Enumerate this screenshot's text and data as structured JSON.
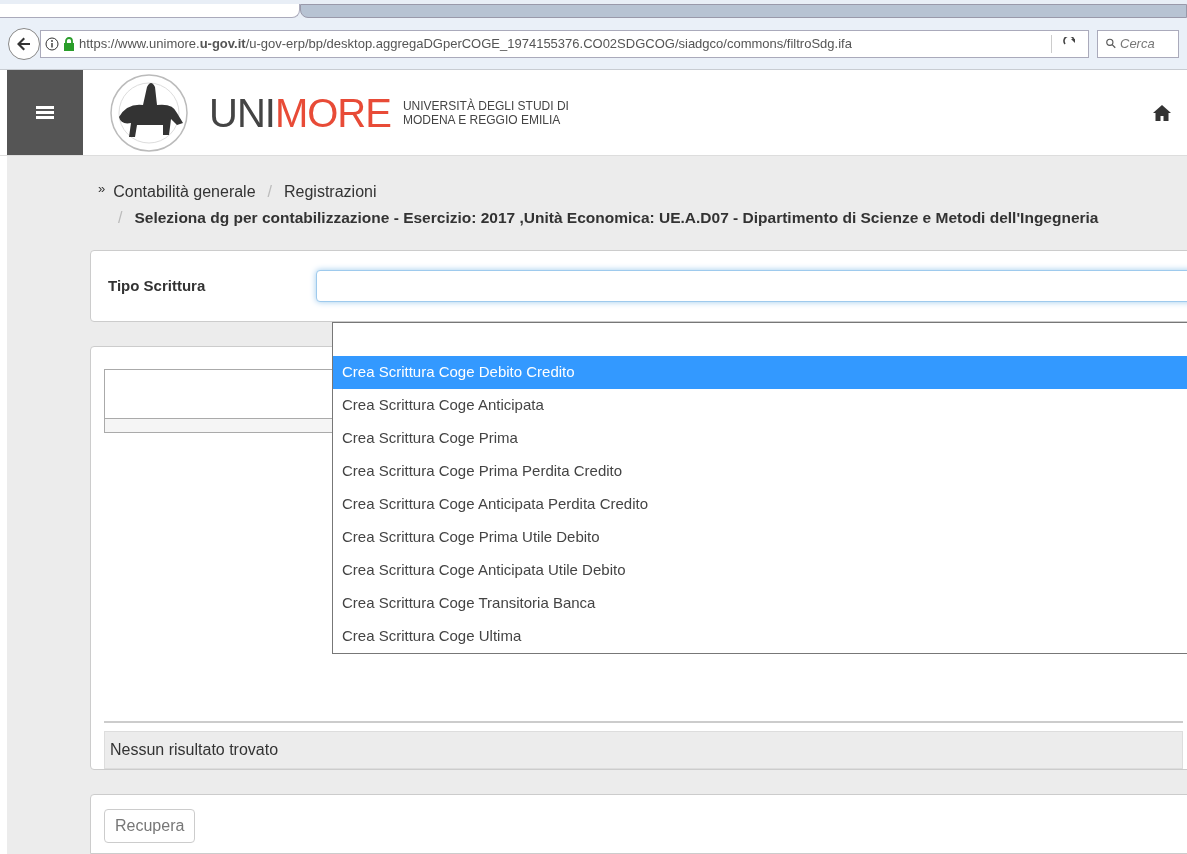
{
  "browser": {
    "url": "https://www.unimore.**u-gov.it**/u-gov-erp/bp/desktop.aggregaDGperCOGE_1974155376.CO02SDGCOG/siadgco/commons/filtroSdg.ifa",
    "search_placeholder": "Cerca"
  },
  "header": {
    "logo_gray": "UNI",
    "logo_red": "MORE",
    "subtitle_1": "UNIVERSITÀ DEGLI STUDI DI",
    "subtitle_2": "MODENA E REGGIO EMILIA"
  },
  "breadcrumb": {
    "mark": "»",
    "items": [
      "Contabilità generale",
      "Registrazioni"
    ],
    "separator": "/",
    "current": "Seleziona dg per contabilizzazione - Esercizio: 2017 ,Unità Economica: UE.A.D07 - Dipartimento di Scienze e Metodi dell'Ingegneria"
  },
  "form": {
    "label": "Tipo Scrittura",
    "dropdown": {
      "expanded": true,
      "options": [
        {
          "selected": false
        },
        {
          "label": "Crea Scrittura Coge Debito Credito",
          "selected": true
        },
        {
          "label": "Crea Scrittura Coge Anticipata",
          "selected": false
        },
        {
          "label": "Crea Scrittura Coge Prima",
          "selected": false
        },
        {
          "label": "Crea Scrittura Coge Prima Perdita Credito",
          "selected": false
        },
        {
          "label": "Crea Scrittura Coge Anticipata Perdita Credito",
          "selected": false
        },
        {
          "label": "Crea Scrittura Coge Prima Utile Debito",
          "selected": false
        },
        {
          "label": "Crea Scrittura Coge Anticipata Utile Debito",
          "selected": false
        },
        {
          "label": "Crea Scrittura Coge Transitoria Banca",
          "selected": false
        },
        {
          "label": "Crea Scrittura Coge Ultima",
          "selected": false
        }
      ]
    }
  },
  "results": {
    "empty_message": "Nessun risultato trovato"
  },
  "buttons": [
    "Recupera"
  ]
}
